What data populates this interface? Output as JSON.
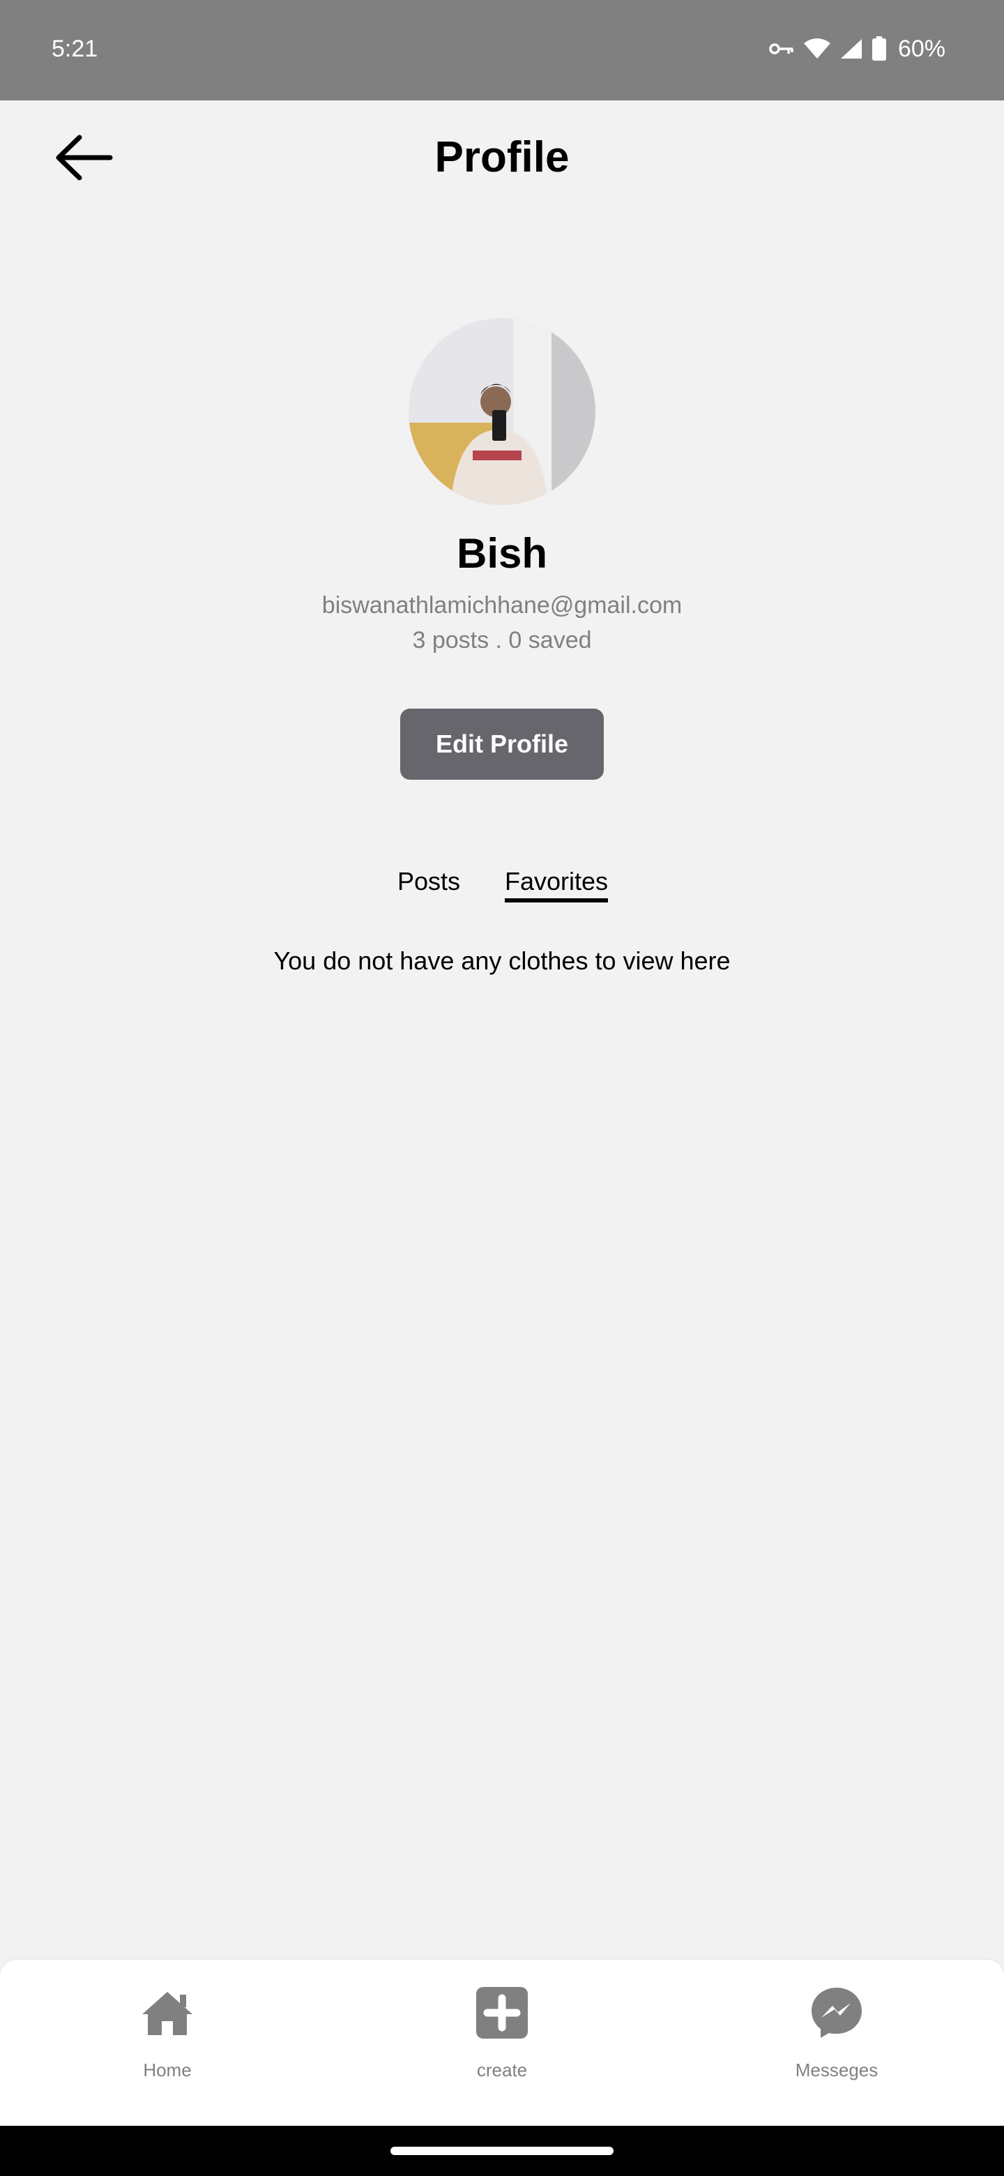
{
  "status_bar": {
    "time": "5:21",
    "battery": "60%",
    "icons": [
      "vpn-key-icon",
      "wifi-icon",
      "signal-icon",
      "battery-icon"
    ]
  },
  "header": {
    "title": "Profile",
    "back_icon": "arrow-left-icon"
  },
  "profile": {
    "name": "Bish",
    "email": "biswanathlamichhane@gmail.com",
    "stats": "3 posts .  0 saved",
    "edit_button_label": "Edit Profile"
  },
  "tabs": [
    {
      "label": "Posts",
      "active": false
    },
    {
      "label": "Favorites",
      "active": true
    }
  ],
  "empty_message": "You do not have any clothes to view here",
  "bottom_nav": [
    {
      "label": "Home",
      "icon": "home-icon"
    },
    {
      "label": "create",
      "icon": "plus-square-icon"
    },
    {
      "label": "Messeges",
      "icon": "messenger-icon"
    }
  ],
  "colors": {
    "background": "#f2f2f2",
    "status_bar": "#808080",
    "button": "#66666c",
    "muted_text": "#808080"
  }
}
